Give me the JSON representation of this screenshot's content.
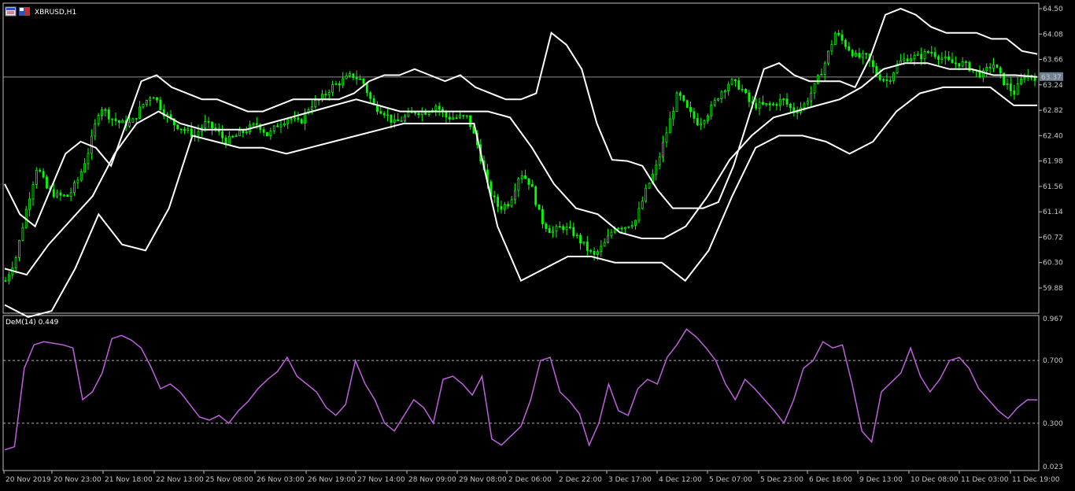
{
  "symbol_title": "XBRUSD,H1",
  "indicator_title": "DeM(14) 0.449",
  "current_price_label": "63.37",
  "colors": {
    "background": "#000000",
    "frame": "#c0c0c0",
    "candle": "#00ff00",
    "bands": "#ffffff",
    "indicator": "#c060e0",
    "level_line": "#b0b0b0",
    "price_marker_bg": "#708090"
  },
  "icons": [
    "chart-window-icon",
    "symbol-flag-icon"
  ],
  "chart_data": [
    {
      "type": "candlestick",
      "title": "XBRUSD,H1",
      "y_ticks": [
        "64.50",
        "64.08",
        "63.66",
        "63.24",
        "62.82",
        "62.40",
        "61.98",
        "61.56",
        "61.14",
        "60.72",
        "60.30",
        "59.88"
      ],
      "ylim": [
        59.58,
        64.55
      ],
      "current_price": 63.37,
      "x_ticks": [
        "20 Nov 2019",
        "20 Nov 23:00",
        "21 Nov 18:00",
        "22 Nov 13:00",
        "25 Nov 08:00",
        "26 Nov 03:00",
        "26 Nov 19:00",
        "27 Nov 14:00",
        "28 Nov 09:00",
        "29 Nov 08:00",
        "2 Dec 06:00",
        "2 Dec 22:00",
        "3 Dec 17:00",
        "4 Dec 12:00",
        "5 Dec 07:00",
        "5 Dec 23:00",
        "6 Dec 18:00",
        "9 Dec 13:00",
        "10 Dec 08:00",
        "11 Dec 03:00",
        "11 Dec 19:00"
      ],
      "close_path": [
        60.0,
        60.4,
        61.2,
        61.9,
        61.5,
        61.4,
        61.4,
        61.7,
        62.2,
        62.9,
        62.7,
        62.6,
        62.6,
        62.9,
        63.1,
        62.8,
        62.6,
        62.5,
        62.4,
        62.6,
        62.5,
        62.3,
        62.4,
        62.5,
        62.6,
        62.4,
        62.6,
        62.7,
        62.6,
        62.9,
        63.0,
        63.2,
        63.3,
        63.4,
        63.3,
        62.9,
        62.8,
        62.6,
        62.7,
        62.8,
        62.8,
        62.9,
        62.7,
        62.7,
        62.7,
        62.2,
        61.5,
        61.2,
        61.3,
        61.8,
        61.6,
        61.0,
        60.8,
        60.9,
        60.8,
        60.6,
        60.4,
        60.6,
        60.9,
        60.9,
        61.0,
        61.5,
        61.9,
        62.5,
        63.1,
        62.8,
        62.6,
        62.8,
        63.1,
        63.3,
        63.2,
        62.9,
        62.9,
        62.9,
        63.0,
        62.8,
        62.9,
        63.2,
        63.6,
        64.1,
        63.9,
        63.7,
        63.7,
        63.4,
        63.3,
        63.6,
        63.7,
        63.7,
        63.8,
        63.7,
        63.6,
        63.6,
        63.5,
        63.4,
        63.6,
        63.3,
        63.1,
        63.4,
        63.37
      ],
      "upper_band": [
        61.6,
        61.1,
        60.9,
        61.5,
        62.1,
        62.3,
        62.2,
        61.9,
        62.6,
        63.3,
        63.4,
        63.2,
        63.1,
        63.0,
        63.0,
        62.9,
        62.8,
        62.8,
        62.9,
        63.0,
        63.0,
        63.0,
        63.0,
        63.1,
        63.3,
        63.4,
        63.4,
        63.5,
        63.4,
        63.3,
        63.4,
        63.2,
        63.1,
        63.0,
        63.0,
        63.1,
        64.1,
        63.9,
        63.5,
        62.6,
        62.0,
        61.98,
        61.9,
        61.5,
        61.2,
        61.2,
        61.2,
        61.3,
        61.9,
        62.7,
        63.5,
        63.6,
        63.4,
        63.3,
        63.3,
        63.3,
        63.2,
        63.7,
        64.4,
        64.5,
        64.4,
        64.2,
        64.1,
        64.1,
        64.1,
        64.0,
        64.0,
        63.8,
        63.75
      ],
      "middle_band": [
        60.2,
        60.1,
        60.6,
        61.0,
        61.4,
        62.1,
        62.6,
        62.8,
        62.6,
        62.5,
        62.5,
        62.5,
        62.6,
        62.7,
        62.8,
        62.9,
        63.0,
        62.9,
        62.8,
        62.8,
        62.8,
        62.8,
        62.8,
        62.7,
        62.2,
        61.6,
        61.2,
        61.1,
        60.8,
        60.7,
        60.7,
        60.9,
        61.4,
        62.0,
        62.4,
        62.7,
        62.8,
        62.9,
        63.0,
        63.2,
        63.5,
        63.6,
        63.6,
        63.5,
        63.5,
        63.4,
        63.4,
        63.37
      ],
      "lower_band": [
        59.6,
        59.4,
        59.5,
        60.2,
        61.1,
        60.6,
        60.5,
        61.2,
        62.4,
        62.3,
        62.2,
        62.2,
        62.1,
        62.2,
        62.3,
        62.4,
        62.5,
        62.6,
        62.6,
        62.6,
        62.6,
        60.9,
        60.0,
        60.2,
        60.4,
        60.4,
        60.3,
        60.3,
        60.3,
        60.0,
        60.5,
        61.4,
        62.2,
        62.4,
        62.4,
        62.3,
        62.1,
        62.3,
        62.8,
        63.1,
        63.2,
        63.2,
        63.2,
        62.9,
        62.9
      ]
    },
    {
      "type": "line",
      "title": "DeM(14) 0.449",
      "y_ticks": [
        "0.967",
        "0.700",
        "0.300",
        "0.023"
      ],
      "ylim": [
        0.023,
        0.967
      ],
      "levels": [
        0.7,
        0.3
      ],
      "current_value": 0.449,
      "values": [
        0.13,
        0.15,
        0.65,
        0.8,
        0.82,
        0.81,
        0.8,
        0.78,
        0.45,
        0.5,
        0.62,
        0.84,
        0.86,
        0.83,
        0.78,
        0.66,
        0.52,
        0.55,
        0.5,
        0.42,
        0.34,
        0.32,
        0.35,
        0.3,
        0.38,
        0.44,
        0.52,
        0.58,
        0.63,
        0.72,
        0.6,
        0.55,
        0.5,
        0.4,
        0.35,
        0.42,
        0.7,
        0.55,
        0.45,
        0.3,
        0.25,
        0.35,
        0.45,
        0.4,
        0.3,
        0.58,
        0.6,
        0.55,
        0.48,
        0.6,
        0.2,
        0.16,
        0.22,
        0.28,
        0.45,
        0.7,
        0.72,
        0.5,
        0.44,
        0.36,
        0.16,
        0.3,
        0.55,
        0.38,
        0.35,
        0.52,
        0.58,
        0.55,
        0.72,
        0.8,
        0.9,
        0.85,
        0.78,
        0.7,
        0.55,
        0.45,
        0.58,
        0.52,
        0.45,
        0.38,
        0.3,
        0.45,
        0.65,
        0.7,
        0.82,
        0.78,
        0.8,
        0.55,
        0.25,
        0.18,
        0.5,
        0.56,
        0.62,
        0.78,
        0.6,
        0.5,
        0.58,
        0.7,
        0.72,
        0.65,
        0.52,
        0.45,
        0.38,
        0.33,
        0.4,
        0.45,
        0.449
      ]
    }
  ]
}
